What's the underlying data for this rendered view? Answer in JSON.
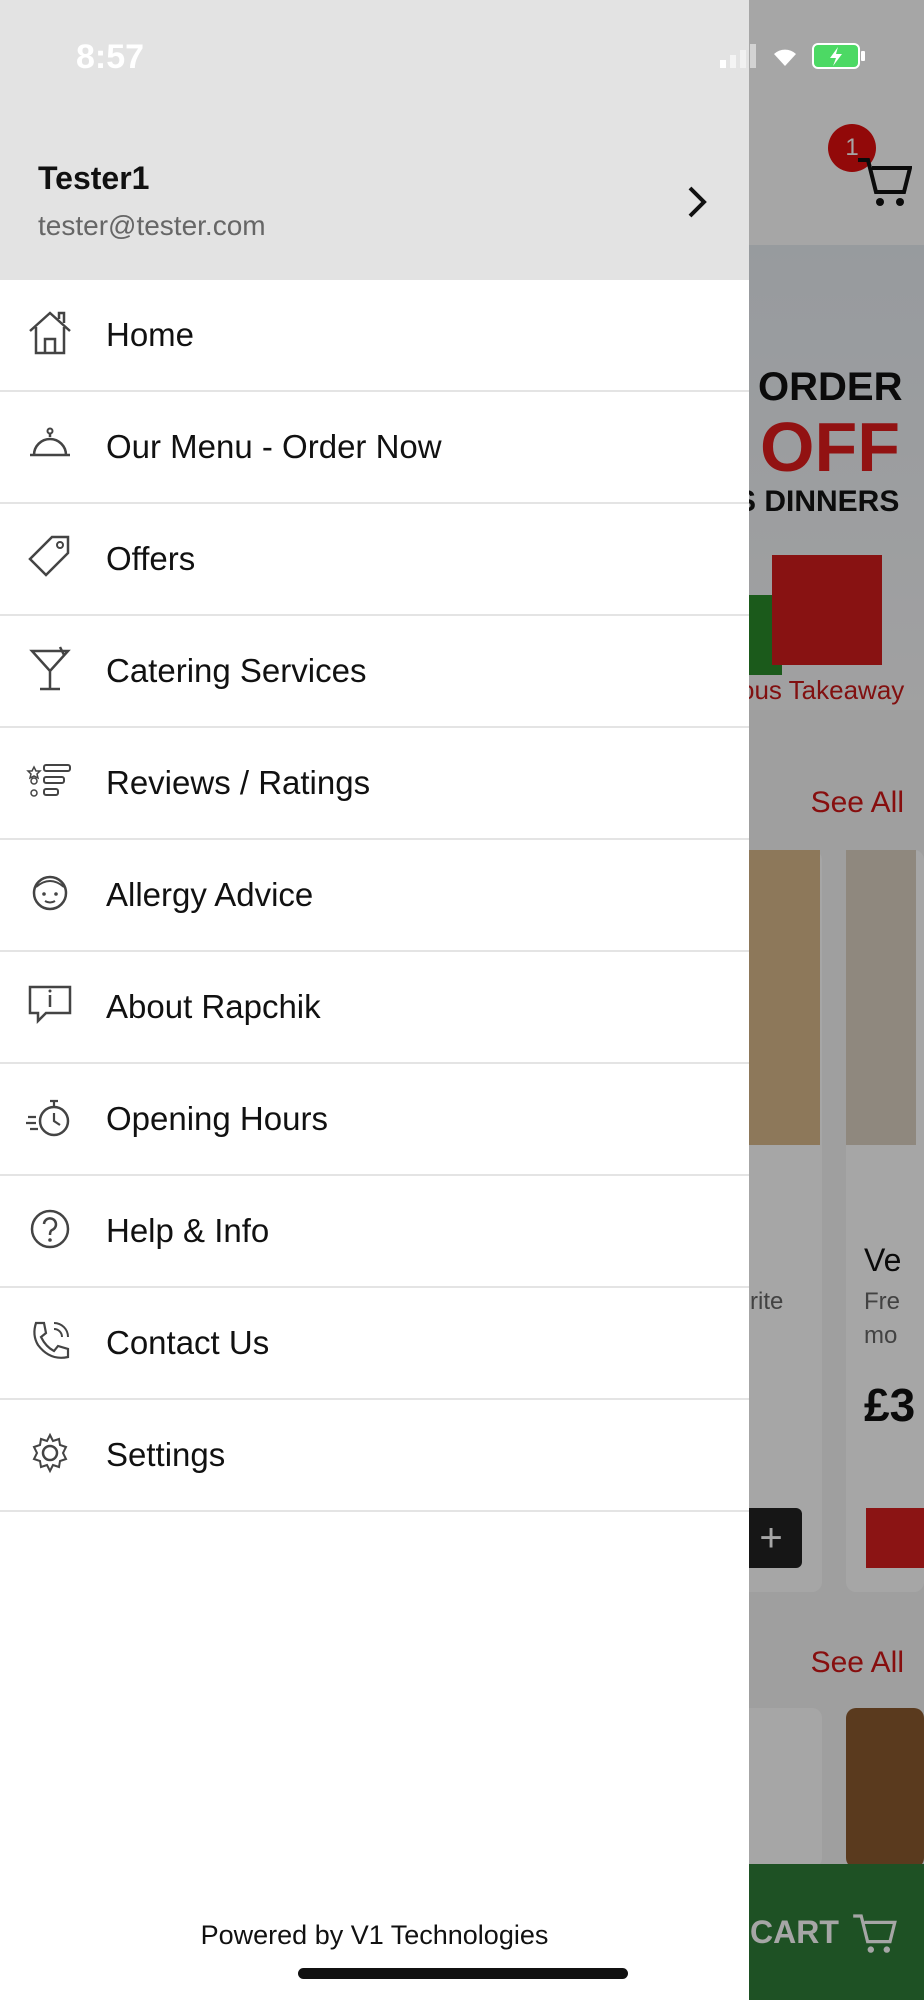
{
  "status_bar": {
    "time": "8:57"
  },
  "background": {
    "cart_badge_count": "1",
    "banner": {
      "line1": "ORDER",
      "line2": "OFF",
      "line3": "S DINNERS",
      "line4": "ous Takeaway"
    },
    "see_all_1": "See All",
    "see_all_2": "See All",
    "card_text_1": "rite",
    "card_text_2": "Ve",
    "card_text_3": "Fre",
    "card_text_4": "mo",
    "price_fragment": "£3",
    "cart_bar_label": "CART"
  },
  "drawer": {
    "profile": {
      "name": "Tester1",
      "email": "tester@tester.com"
    },
    "menu": [
      {
        "label": "Home",
        "icon": "home-icon"
      },
      {
        "label": "Our Menu - Order Now",
        "icon": "cloche-icon"
      },
      {
        "label": "Offers",
        "icon": "tag-icon"
      },
      {
        "label": "Catering Services",
        "icon": "cocktail-icon"
      },
      {
        "label": "Reviews / Ratings",
        "icon": "reviews-icon"
      },
      {
        "label": "Allergy Advice",
        "icon": "face-icon"
      },
      {
        "label": "About Rapchik",
        "icon": "info-bubble-icon"
      },
      {
        "label": "Opening Hours",
        "icon": "stopwatch-icon"
      },
      {
        "label": "Help & Info",
        "icon": "help-icon"
      },
      {
        "label": "Contact Us",
        "icon": "phone-icon"
      },
      {
        "label": "Settings",
        "icon": "gear-icon"
      }
    ],
    "footer": "Powered by V1 Technologies"
  },
  "colors": {
    "accent_red": "#d01616",
    "cart_green": "#2e7d38"
  }
}
